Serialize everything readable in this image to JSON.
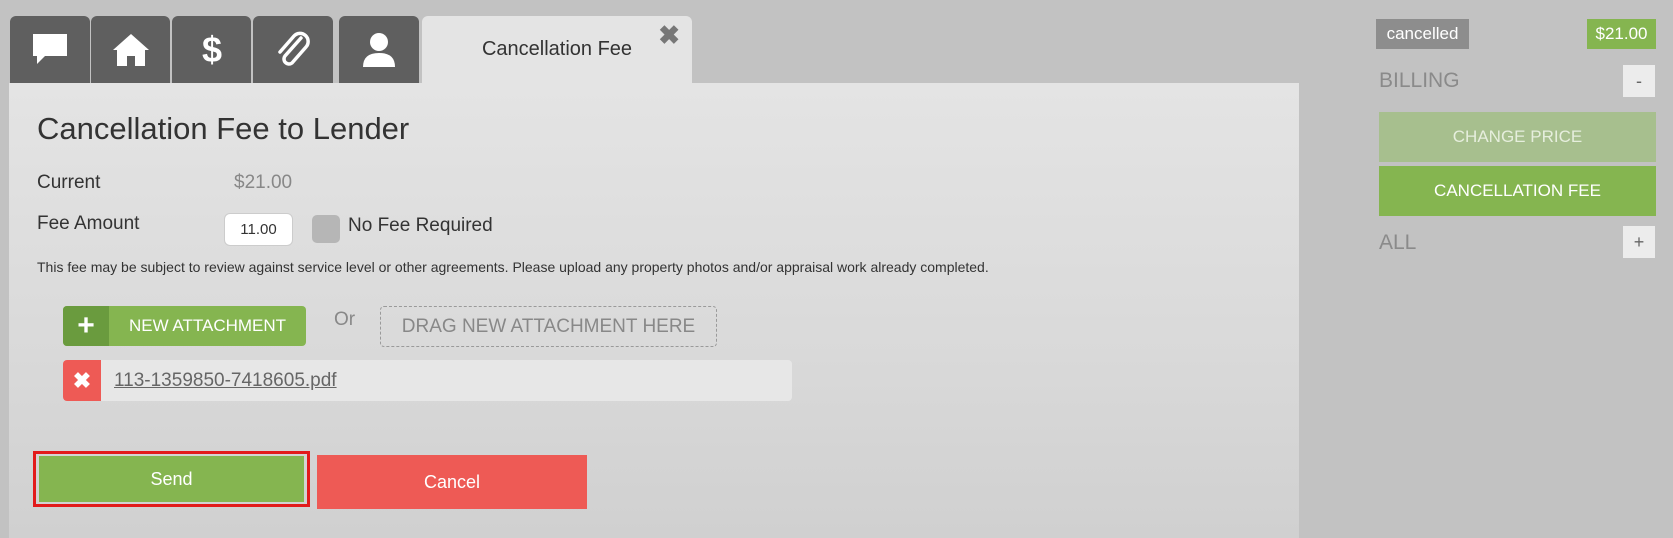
{
  "tabs": {
    "icons": [
      "chat-icon",
      "home-icon",
      "dollar-icon",
      "paperclip-icon",
      "user-icon"
    ],
    "active_label": "Cancellation Fee",
    "close_symbol": "✖"
  },
  "form": {
    "title": "Cancellation Fee to Lender",
    "current_label": "Current",
    "current_value": "$21.00",
    "fee_label": "Fee Amount",
    "fee_value": "11.00",
    "no_fee_label": "No Fee Required",
    "note": "This fee may be subject to review against service level or other agreements. Please upload any property photos and/or appraisal work already completed."
  },
  "attachments": {
    "new_button_icon": "+",
    "new_button_label": "NEW ATTACHMENT",
    "or_text": "Or",
    "drop_zone_label": "DRAG NEW ATTACHMENT HERE",
    "files": [
      {
        "remove_icon": "✖",
        "name": "113-1359850-7418605.pdf"
      }
    ]
  },
  "actions": {
    "send_label": "Send",
    "cancel_label": "Cancel"
  },
  "sidebar": {
    "status": "cancelled",
    "price": "$21.00",
    "billing_label": "BILLING",
    "billing_toggle": "-",
    "change_price_label": "CHANGE PRICE",
    "cancellation_fee_label": "CANCELLATION FEE",
    "all_label": "ALL",
    "all_toggle": "+"
  },
  "colors": {
    "accent_green": "#85b550",
    "danger_red": "#ee5a55",
    "highlight_border": "#e21b1b"
  }
}
